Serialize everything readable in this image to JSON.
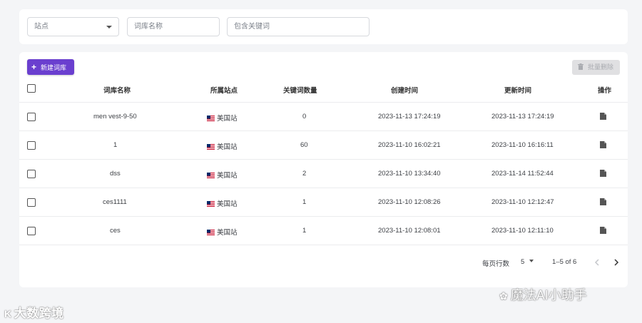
{
  "filters": {
    "site_placeholder": "站点",
    "name_placeholder": "词库名称",
    "keyword_placeholder": "包含关键词"
  },
  "toolbar": {
    "new_label": "新建词库",
    "batch_delete_label": "批量删除"
  },
  "table": {
    "headers": {
      "name": "词库名称",
      "site": "所属站点",
      "count": "关键词数量",
      "created": "创建时间",
      "updated": "更新时间",
      "actions": "操作"
    },
    "rows": [
      {
        "name": "men vest-9-50",
        "site": "美国站",
        "count": "0",
        "created": "2023-11-13 17:24:19",
        "updated": "2023-11-13 17:24:19"
      },
      {
        "name": "1",
        "site": "美国站",
        "count": "60",
        "created": "2023-11-10 16:02:21",
        "updated": "2023-11-10 16:16:11"
      },
      {
        "name": "dss",
        "site": "美国站",
        "count": "2",
        "created": "2023-11-10 13:34:40",
        "updated": "2023-11-14 11:52:44"
      },
      {
        "name": "ces1111",
        "site": "美国站",
        "count": "1",
        "created": "2023-11-10 12:08:26",
        "updated": "2023-11-10 12:12:47"
      },
      {
        "name": "ces",
        "site": "美国站",
        "count": "1",
        "created": "2023-11-10 12:08:01",
        "updated": "2023-11-10 12:11:10"
      }
    ]
  },
  "pagination": {
    "rows_per_page_label": "每页行数",
    "rows_per_page_value": "5",
    "range_text": "1–5 of 6"
  },
  "watermarks": {
    "left": "大数跨境",
    "right": "魔法AI小助手"
  },
  "colors": {
    "accent": "#6a3fcf",
    "disabled_bg": "#e0e0e2",
    "page_bg": "#f4f5f7"
  },
  "icons": [
    "chevron-down-icon",
    "plus-icon",
    "trash-icon",
    "checkbox-icon",
    "us-flag-icon",
    "document-icon",
    "chevron-left-icon",
    "chevron-right-icon"
  ]
}
